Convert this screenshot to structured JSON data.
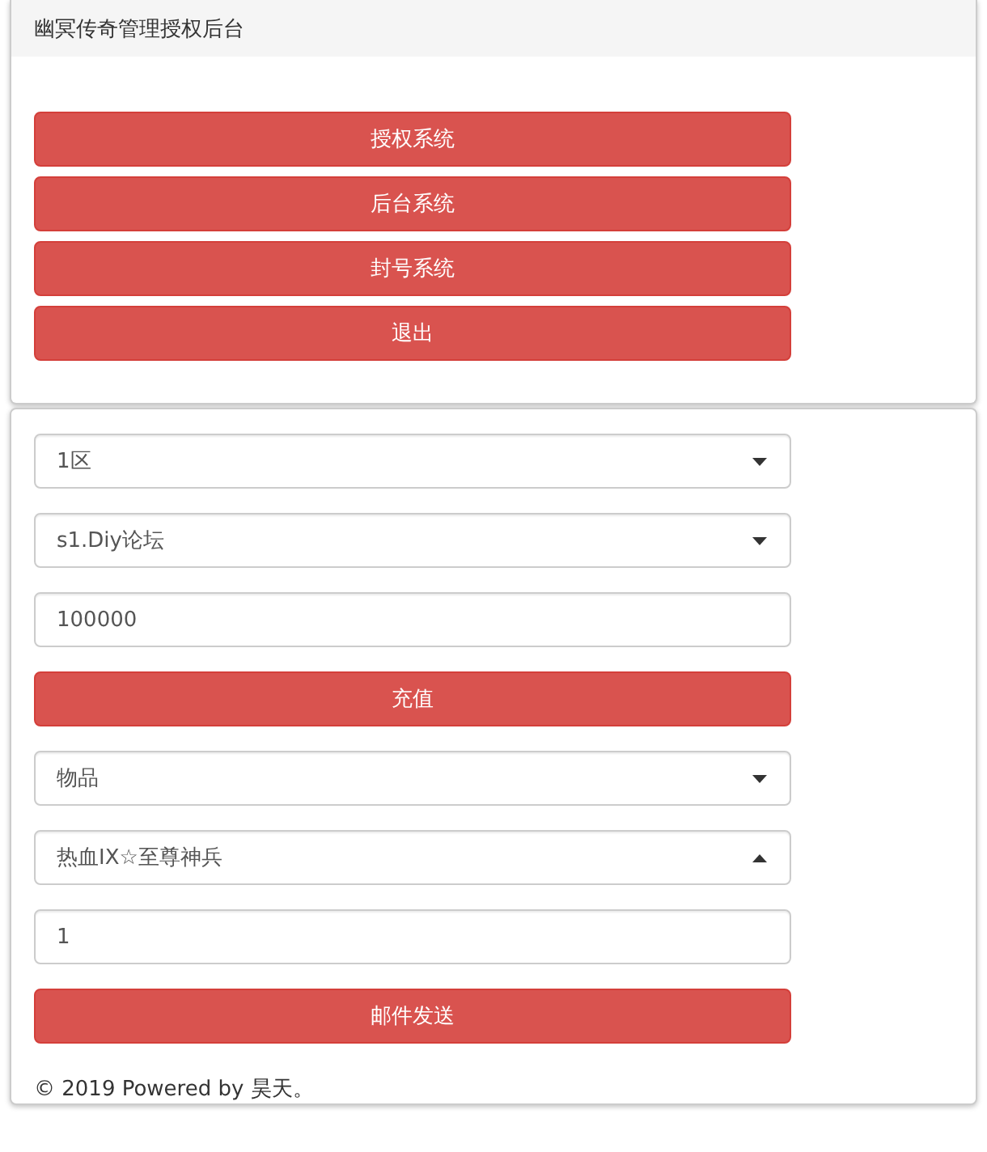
{
  "header": {
    "title": "幽冥传奇管理授权后台"
  },
  "menu_buttons": [
    "授权系统",
    "后台系统",
    "封号系统",
    "退出"
  ],
  "form": [
    {
      "kind": "select",
      "value": "1区",
      "expanded": false
    },
    {
      "kind": "select",
      "value": "s1.Diy论坛",
      "expanded": false
    },
    {
      "kind": "input",
      "value": "100000"
    },
    {
      "kind": "button",
      "label": "充值"
    },
    {
      "kind": "select",
      "value": "物品",
      "expanded": false
    },
    {
      "kind": "select",
      "value": "热血IX☆至尊神兵",
      "expanded": true
    },
    {
      "kind": "input",
      "value": "1"
    },
    {
      "kind": "button",
      "label": "邮件发送"
    }
  ],
  "footer": "© 2019 Powered by 昊天。"
}
